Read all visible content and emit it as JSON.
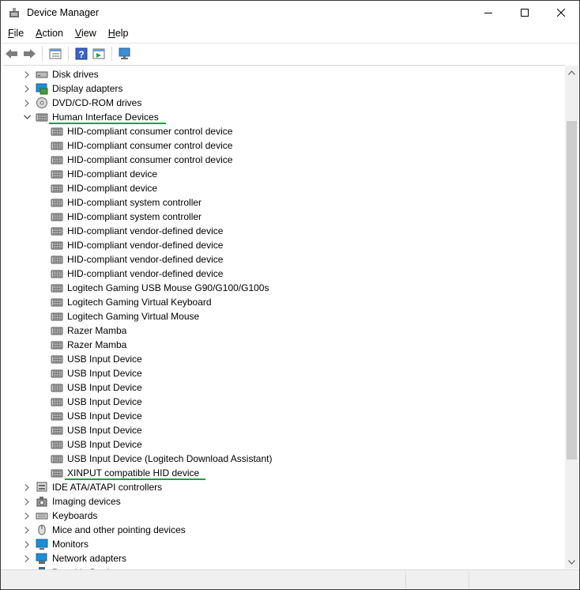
{
  "window": {
    "title": "Device Manager"
  },
  "menu": [
    {
      "label": "File",
      "key": "F",
      "rest": "ile"
    },
    {
      "label": "Action",
      "key": "A",
      "rest": "ction"
    },
    {
      "label": "View",
      "key": "V",
      "rest": "iew"
    },
    {
      "label": "Help",
      "key": "H",
      "rest": "elp"
    }
  ],
  "toolbar": [
    "back-icon",
    "forward-icon",
    "properties-list-icon",
    "help-icon",
    "action-pane-icon",
    "monitor-scan-icon"
  ],
  "tree": {
    "categories_before": [
      {
        "label": "Disk drives",
        "icon": "disk-drive-icon"
      },
      {
        "label": "Display adapters",
        "icon": "display-adapter-icon"
      },
      {
        "label": "DVD/CD-ROM drives",
        "icon": "dvd-drive-icon"
      }
    ],
    "expanded_category": {
      "label": "Human Interface Devices",
      "icon": "hid-icon"
    },
    "hid_children": [
      "HID-compliant consumer control device",
      "HID-compliant consumer control device",
      "HID-compliant consumer control device",
      "HID-compliant device",
      "HID-compliant device",
      "HID-compliant system controller",
      "HID-compliant system controller",
      "HID-compliant vendor-defined device",
      "HID-compliant vendor-defined device",
      "HID-compliant vendor-defined device",
      "HID-compliant vendor-defined device",
      "Logitech Gaming USB Mouse G90/G100/G100s",
      "Logitech Gaming Virtual Keyboard",
      "Logitech Gaming Virtual Mouse",
      "Razer Mamba",
      "Razer Mamba",
      "USB Input Device",
      "USB Input Device",
      "USB Input Device",
      "USB Input Device",
      "USB Input Device",
      "USB Input Device",
      "USB Input Device",
      "USB Input Device (Logitech Download Assistant)",
      "XINPUT compatible HID device"
    ],
    "categories_after": [
      {
        "label": "IDE ATA/ATAPI controllers",
        "icon": "ide-controller-icon"
      },
      {
        "label": "Imaging devices",
        "icon": "camera-icon"
      },
      {
        "label": "Keyboards",
        "icon": "keyboard-icon"
      },
      {
        "label": "Mice and other pointing devices",
        "icon": "mouse-icon"
      },
      {
        "label": "Monitors",
        "icon": "monitor-icon"
      },
      {
        "label": "Network adapters",
        "icon": "network-adapter-icon"
      },
      {
        "label": "Portable Devices",
        "icon": "portable-device-icon"
      }
    ]
  },
  "colors": {
    "highlight_underline": "#17a23a",
    "monitor_blue": "#1a8fd8"
  }
}
